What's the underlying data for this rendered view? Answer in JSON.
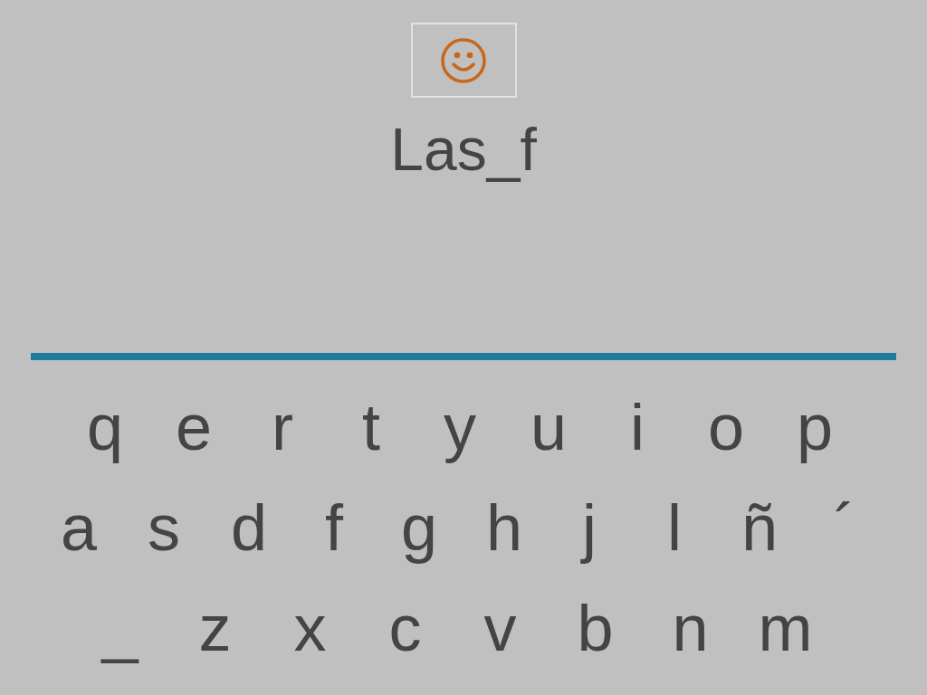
{
  "word": "Las_f",
  "keyboard": {
    "rows": [
      [
        "q",
        "e",
        "r",
        "t",
        "y",
        "u",
        "i",
        "o",
        "p"
      ],
      [
        "a",
        "s",
        "d",
        "f",
        "g",
        "h",
        "j",
        "l",
        "ñ",
        "´"
      ],
      [
        "_",
        "z",
        "x",
        "c",
        "v",
        "b",
        "n",
        "m"
      ]
    ]
  }
}
